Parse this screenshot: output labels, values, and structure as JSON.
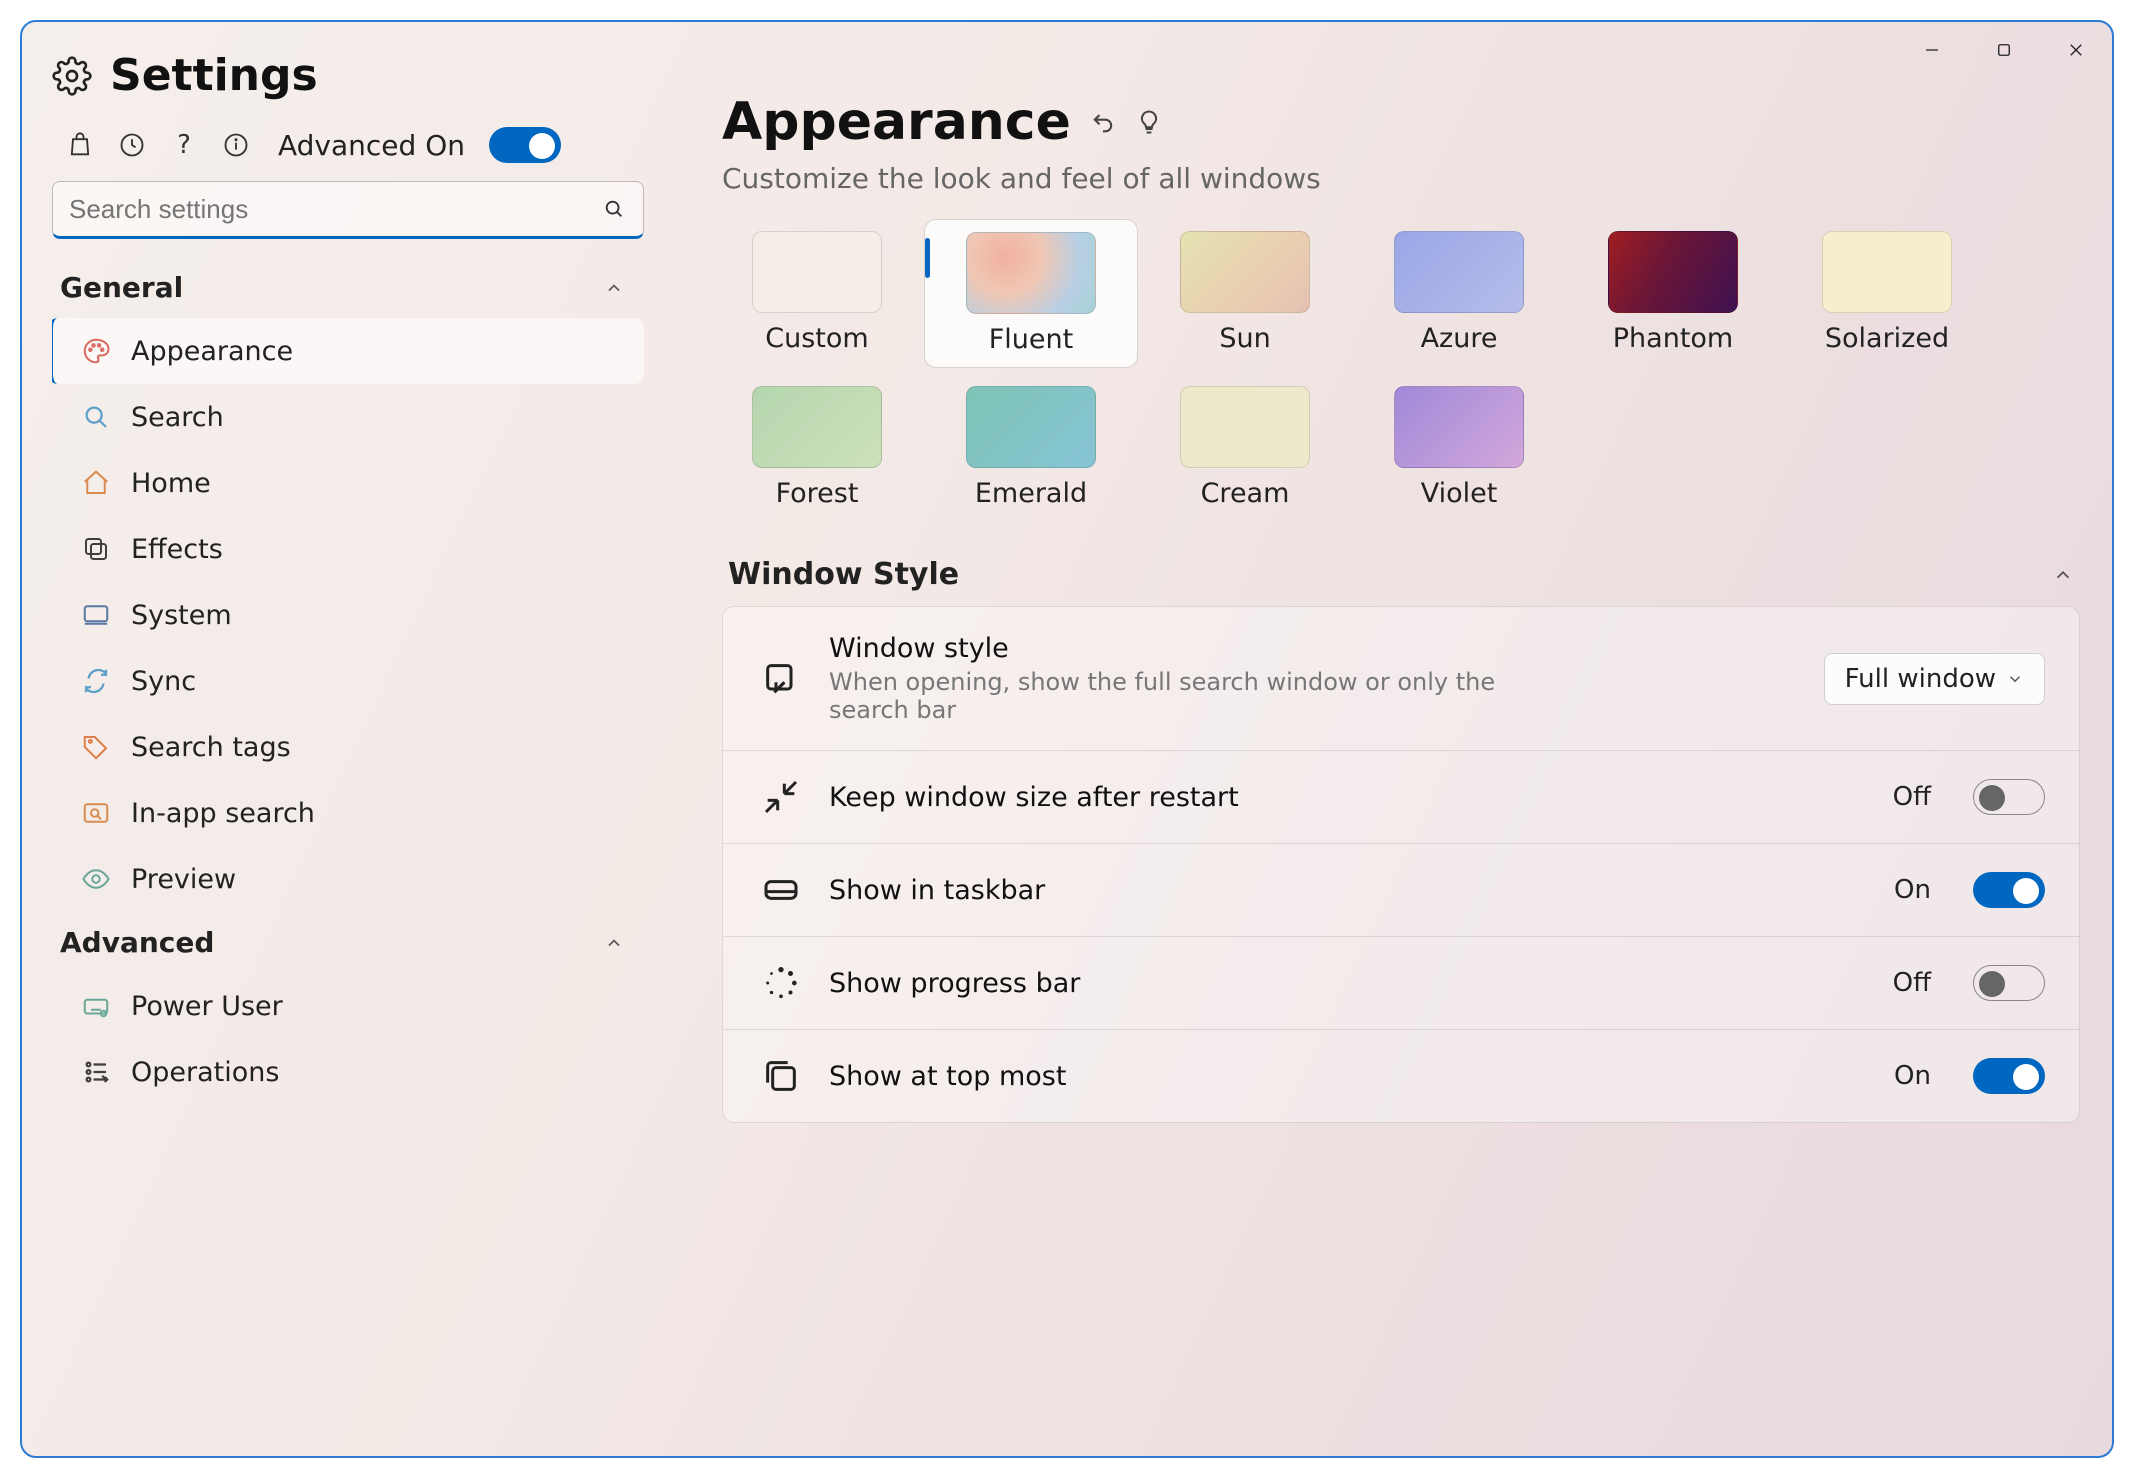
{
  "app_title": "Settings",
  "sidebar": {
    "advanced_toggle_label": "Advanced On",
    "advanced_toggle_state": "on",
    "search_placeholder": "Search settings",
    "groups": [
      {
        "label": "General",
        "items": [
          {
            "icon": "palette",
            "label": "Appearance",
            "color": "#d96b5e",
            "active": true
          },
          {
            "icon": "search",
            "label": "Search",
            "color": "#5fa0c9"
          },
          {
            "icon": "home",
            "label": "Home",
            "color": "#d98b4f"
          },
          {
            "icon": "effects",
            "label": "Effects",
            "color": "#3f3f3f"
          },
          {
            "icon": "monitor",
            "label": "System",
            "color": "#5a7aa3"
          },
          {
            "icon": "sync",
            "label": "Sync",
            "color": "#5fa0c9"
          },
          {
            "icon": "tag",
            "label": "Search tags",
            "color": "#e07e4b"
          },
          {
            "icon": "inapp",
            "label": "In-app search",
            "color": "#d98b4f"
          },
          {
            "icon": "eye",
            "label": "Preview",
            "color": "#6aa89a"
          }
        ]
      },
      {
        "label": "Advanced",
        "items": [
          {
            "icon": "keyboard",
            "label": "Power User",
            "color": "#6aa89a"
          },
          {
            "icon": "ops",
            "label": "Operations",
            "color": "#3f3f3f"
          }
        ]
      }
    ]
  },
  "main": {
    "title": "Appearance",
    "subtitle": "Customize the look and feel of all windows",
    "themes": [
      {
        "name": "Custom",
        "cls": "sw-custom"
      },
      {
        "name": "Fluent",
        "cls": "sw-fluent",
        "selected": true
      },
      {
        "name": "Sun",
        "cls": "sw-sun"
      },
      {
        "name": "Azure",
        "cls": "sw-azure"
      },
      {
        "name": "Phantom",
        "cls": "sw-phantom"
      },
      {
        "name": "Solarized",
        "cls": "sw-solarized"
      },
      {
        "name": "Forest",
        "cls": "sw-forest"
      },
      {
        "name": "Emerald",
        "cls": "sw-emerald"
      },
      {
        "name": "Cream",
        "cls": "sw-cream"
      },
      {
        "name": "Violet",
        "cls": "sw-violet"
      }
    ],
    "section_title": "Window Style",
    "rows": [
      {
        "icon": "window-style",
        "title": "Window style",
        "desc": "When opening, show the full search window or only the search bar",
        "control": "dropdown",
        "value": "Full window"
      },
      {
        "icon": "shrink",
        "title": "Keep window size after restart",
        "control": "toggle",
        "state": "Off"
      },
      {
        "icon": "taskbar",
        "title": "Show in taskbar",
        "control": "toggle",
        "state": "On"
      },
      {
        "icon": "spinner",
        "title": "Show progress bar",
        "control": "toggle",
        "state": "Off"
      },
      {
        "icon": "stack",
        "title": "Show at top most",
        "control": "toggle",
        "state": "On"
      }
    ]
  }
}
